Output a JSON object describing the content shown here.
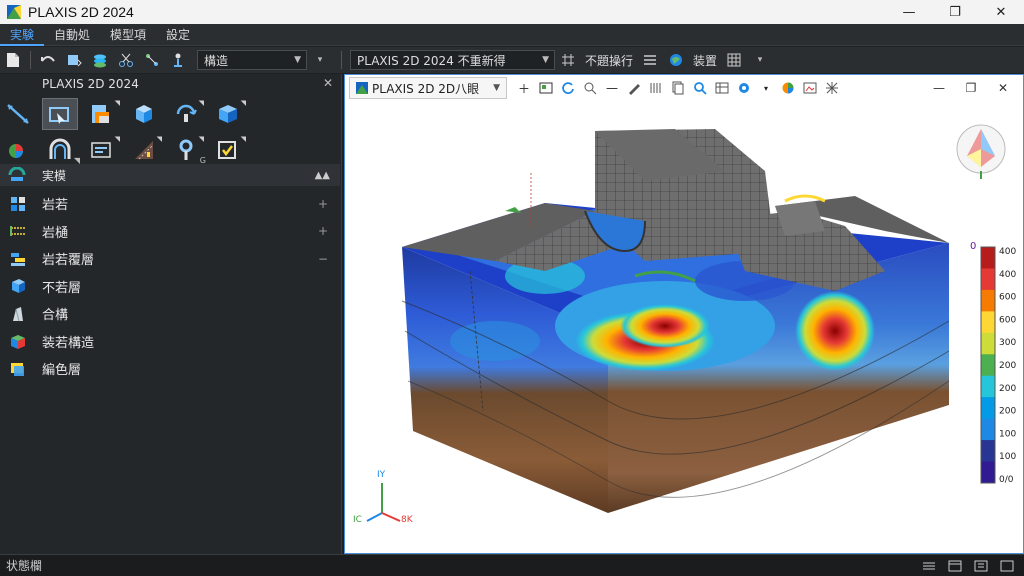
{
  "window": {
    "title": "PLAXIS 2D 2024"
  },
  "menu": {
    "items": [
      "実験",
      "自動処",
      "模型項",
      "設定"
    ],
    "active_index": 0
  },
  "toolbar": {
    "mode_select": "構造",
    "project_select": "PLAXIS 2D 2024  不重新得",
    "search_label": "不題操行",
    "view_label": "装置"
  },
  "left_panel": {
    "title": "PLAXIS 2D 2024",
    "section_label": "実模",
    "items": [
      {
        "label": "岩若",
        "icon": "rock-layers-icon",
        "ctl": "+"
      },
      {
        "label": "岩樋",
        "icon": "channel-icon",
        "ctl": "+"
      },
      {
        "label": "岩若覆層",
        "icon": "cover-layer-icon",
        "ctl": "−"
      },
      {
        "label": "不若層",
        "icon": "non-rock-layer-icon",
        "ctl": ""
      },
      {
        "label": "合構",
        "icon": "structure-icon",
        "ctl": ""
      },
      {
        "label": "装若構造",
        "icon": "assembly-icon",
        "ctl": ""
      },
      {
        "label": "編色層",
        "icon": "color-layer-icon",
        "ctl": ""
      }
    ],
    "tools_row1": [
      "line-tool-icon",
      "select-tool-icon",
      "soil-tool-icon",
      "cube-tool-icon",
      "rotate-tool-icon",
      "volume-tool-icon"
    ],
    "tools_row2": [
      "load-tool-icon",
      "tunnel-tool-icon",
      "mesh-tool-icon",
      "stage-tool-icon",
      "point-tool-icon",
      "check-tool-icon"
    ]
  },
  "viewport": {
    "tab_label": "PLAXIS 2D 2D八眼",
    "axis_labels": {
      "y": "IY",
      "x": "8K",
      "z": "IC"
    }
  },
  "legend": {
    "zero_label": "0",
    "ticks": [
      "400",
      "400",
      "600",
      "600",
      "300",
      "200",
      "200",
      "200",
      "100",
      "100",
      "0/0"
    ],
    "colors": [
      "#b71c1c",
      "#e53935",
      "#f57c00",
      "#fdd835",
      "#cddc39",
      "#4caf50",
      "#26c6da",
      "#039be5",
      "#1e88e5",
      "#283593",
      "#311b92"
    ]
  },
  "status": {
    "text": "状態欄"
  }
}
